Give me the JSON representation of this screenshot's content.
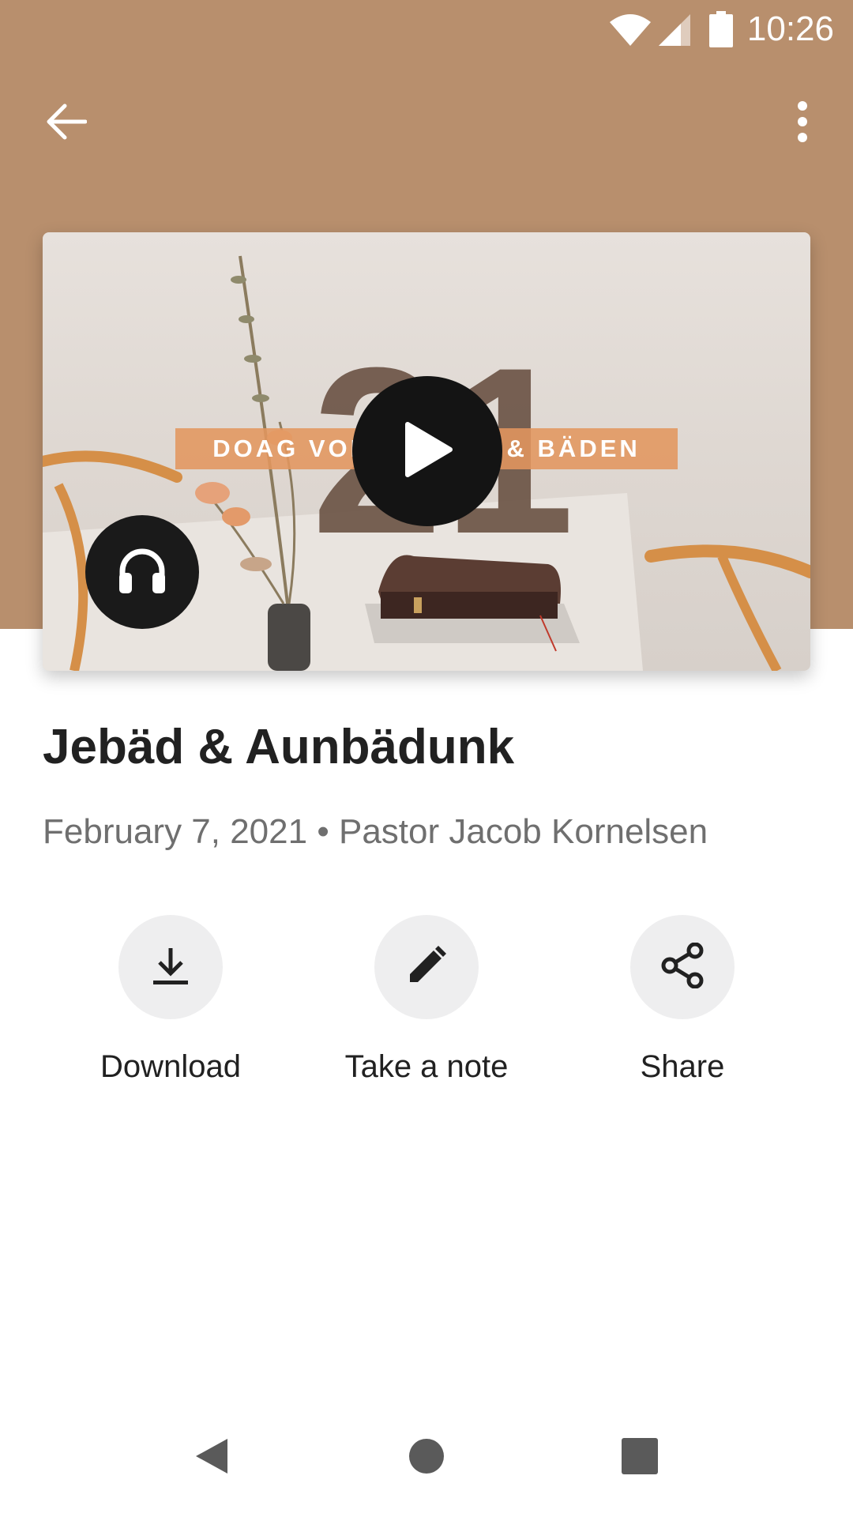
{
  "status_bar": {
    "time": "10:26",
    "icons": [
      "wifi-icon",
      "cell-signal-icon",
      "battery-icon"
    ]
  },
  "app_bar": {
    "back_icon": "arrow-back-icon",
    "more_icon": "more-vert-icon"
  },
  "media": {
    "banner_text": "DOAG VON FASTEN & BÄDEN",
    "big_number": "21",
    "play_icon": "play-icon",
    "audio_icon": "headphones-icon"
  },
  "sermon": {
    "title": "Jebäd & Aunbädunk",
    "date": "February 7, 2021",
    "separator": "•",
    "speaker": "Pastor Jacob Kornelsen"
  },
  "actions": [
    {
      "label": "Download",
      "icon": "download-icon"
    },
    {
      "label": "Take a note",
      "icon": "pencil-icon"
    },
    {
      "label": "Share",
      "icon": "share-icon"
    }
  ],
  "nav_bar": {
    "buttons": [
      "nav-back-icon",
      "nav-home-icon",
      "nav-recents-icon"
    ]
  },
  "colors": {
    "header_brown": "#b88f6d",
    "banner_orange": "#e2965f",
    "text_primary": "#212121",
    "text_secondary": "#6f6f6f",
    "action_bg": "#eeeeef"
  }
}
